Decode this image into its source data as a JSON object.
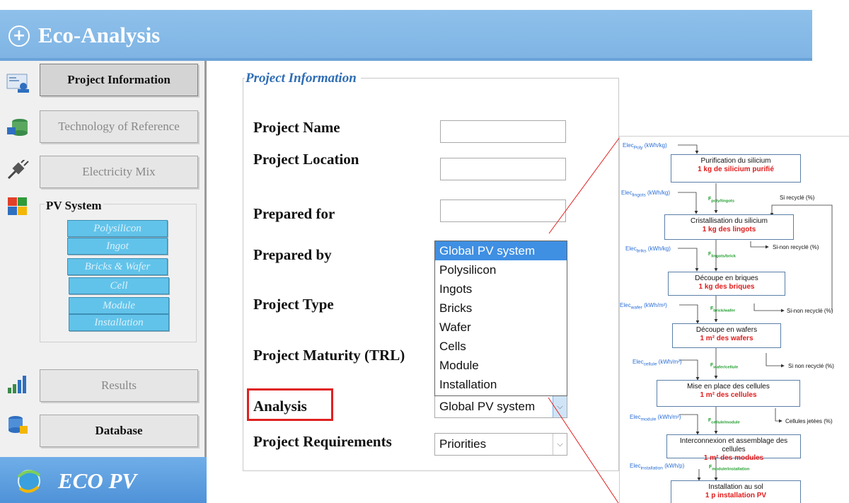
{
  "header": {
    "title": "Eco-Analysis",
    "plus_icon": "+"
  },
  "sidebar": {
    "items": [
      {
        "label": "Project Information",
        "icon": "project-info-icon"
      },
      {
        "label": "Technology of Reference",
        "icon": "database-icon"
      },
      {
        "label": "Electricity Mix",
        "icon": "plug-icon"
      },
      {
        "label": "PV System",
        "icon": "puzzle-icon"
      },
      {
        "label": "Results",
        "icon": "bar-chart-icon"
      },
      {
        "label": "Database",
        "icon": "database-stack-icon"
      }
    ],
    "pv_subitems": [
      "Polysilicon",
      "Ingot",
      "Bricks & Wafer",
      "Cell",
      "Module",
      "Installation"
    ],
    "footer": "ECO PV"
  },
  "form": {
    "group_title": "Project Information",
    "labels": {
      "name": "Project Name",
      "location": "Project Location",
      "prepared_for": "Prepared for",
      "prepared_by": "Prepared by",
      "type": "Project Type",
      "maturity": "Project Maturity (TRL)",
      "analysis": "Analysis",
      "requirements": "Project Requirements"
    },
    "analysis_value": "Global PV system",
    "requirements_value": "Priorities",
    "dropdown_options": [
      "Global PV system",
      "Polysilicon",
      "Ingots",
      "Bricks",
      "Wafer",
      "Cells",
      "Module",
      "Installation"
    ],
    "dropdown_selected": "Global PV system"
  },
  "flow": {
    "steps": [
      {
        "title": "Purification du silicium",
        "output": "1 kg de silicium purifié"
      },
      {
        "title": "Cristallisation du silicium",
        "output": "1 kg des lingots"
      },
      {
        "title": "Découpe en briques",
        "output": "1 kg des briques"
      },
      {
        "title": "Découpe en wafers",
        "output": "1 m² des wafers"
      },
      {
        "title": "Mise en place des cellules",
        "output": "1 m² des cellules"
      },
      {
        "title": "Interconnexion et assemblage des cellules",
        "output": "1 m² des modules"
      },
      {
        "title": "Installation au sol",
        "output": "1 p installation PV"
      }
    ],
    "elec": [
      {
        "base": "Elec",
        "sub": "Poly",
        "unit": "(kWh/kg)"
      },
      {
        "base": "Elec",
        "sub": "lingots",
        "unit": "(kWh/kg)"
      },
      {
        "base": "Elec",
        "sub": "briks",
        "unit": "(kWh/kg)"
      },
      {
        "base": "Elec",
        "sub": "wafer",
        "unit": "(kWh/m²)"
      },
      {
        "base": "Elec",
        "sub": "cellule",
        "unit": "(kWh/m²)"
      },
      {
        "base": "Elec",
        "sub": "module",
        "unit": "(kWh/m²)"
      },
      {
        "base": "Elec",
        "sub": "installation",
        "unit": "(kWh/p)"
      }
    ],
    "flows": [
      {
        "base": "F",
        "sub": "poly/lingots"
      },
      {
        "base": "F",
        "sub": "lingots/brick"
      },
      {
        "base": "F",
        "sub": "brick/wafer"
      },
      {
        "base": "F",
        "sub": "wafer/cellule"
      },
      {
        "base": "F",
        "sub": "cellule/module"
      },
      {
        "base": "F",
        "sub": "module/installation"
      }
    ],
    "side": [
      "Si recyclé (%)",
      "Si-non recyclé (%)",
      "Si-non recyclé (%)",
      "Si non recyclé (%)",
      "Cellules jetées (%)"
    ]
  }
}
